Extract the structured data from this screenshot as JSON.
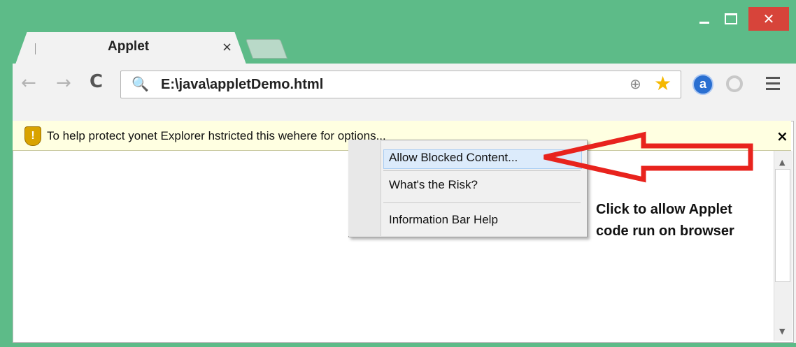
{
  "window": {
    "minimize_label": "_",
    "close_label": "✕"
  },
  "tab": {
    "title": "Applet",
    "close_label": "×"
  },
  "toolbar": {
    "back_icon": "←",
    "forward_icon": "→",
    "reload_icon": "C",
    "url": "E:\\java\\appletDemo.html",
    "search_icon": "🔍",
    "zoom_icon": "⊕",
    "star_icon": "★",
    "extension_label": "a"
  },
  "infobar": {
    "shield_label": "!",
    "text": "To help protect yonet Explorer hstricted this wehere for options...",
    "close_label": "×"
  },
  "context_menu": {
    "items": [
      {
        "label": "Allow Blocked Content..."
      },
      {
        "label": "What's the Risk?"
      },
      {
        "label": "Information Bar Help"
      }
    ]
  },
  "annotation": {
    "line1": "Click to allow Applet",
    "line2": "code run on browser",
    "arrow_color": "#e8231d"
  },
  "scrollbar": {
    "up_icon": "▲",
    "down_icon": "▼"
  }
}
